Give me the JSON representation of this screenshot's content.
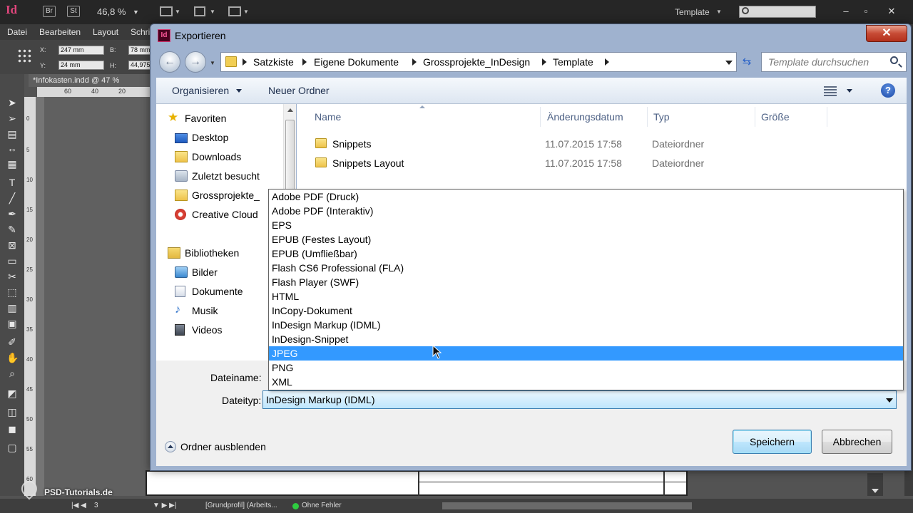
{
  "app": {
    "logo": "Id",
    "badge_bridge": "Br",
    "badge_stock": "St",
    "zoom": "46,8 %",
    "workspace": "Template",
    "menu": [
      "Datei",
      "Bearbeiten",
      "Layout",
      "Schri"
    ],
    "x_label": "X:",
    "y_label": "Y:",
    "w_label": "B:",
    "h_label": "H:",
    "x_value": "247 mm",
    "y_value": "24 mm",
    "w_value": "78 mm",
    "h_value": "44,975",
    "doc_tab": "*Infokasten.indd @ 47 %",
    "ruler_top": [
      "60",
      "40",
      "20"
    ],
    "ruler_left": [
      "0",
      "5",
      "10",
      "15",
      "20",
      "25",
      "30",
      "35",
      "40",
      "45",
      "50",
      "55",
      "60"
    ],
    "status": {
      "page": "3",
      "profile": "[Grundprofil] (Arbeits...",
      "preflight": "Ohne Fehler"
    },
    "watermark": "PSD-Tutorials.de"
  },
  "dialog": {
    "title": "Exportieren",
    "title_icon": "Id",
    "breadcrumb": [
      "Satzkiste",
      "Eigene Dokumente",
      "Grossprojekte_InDesign",
      "Template"
    ],
    "search_placeholder": "Template durchsuchen",
    "toolbar": {
      "organize": "Organisieren",
      "new_folder": "Neuer Ordner"
    },
    "nav": {
      "favorites_header": "Favoriten",
      "favorites": [
        "Desktop",
        "Downloads",
        "Zuletzt besucht",
        "Grossprojekte_",
        "Creative Cloud"
      ],
      "libraries_header": "Bibliotheken",
      "libraries": [
        "Bilder",
        "Dokumente",
        "Musik",
        "Videos"
      ]
    },
    "columns": {
      "name": "Name",
      "date": "Änderungsdatum",
      "type": "Typ",
      "size": "Größe"
    },
    "files": [
      {
        "name": "Snippets",
        "date": "11.07.2015 17:58",
        "type": "Dateiordner"
      },
      {
        "name": "Snippets Layout",
        "date": "11.07.2015 17:58",
        "type": "Dateiordner"
      }
    ],
    "filename_label": "Dateiname:",
    "filetype_label": "Dateityp:",
    "filetype_value": "InDesign Markup (IDML)",
    "filetype_options": [
      "Adobe PDF (Druck)",
      "Adobe PDF (Interaktiv)",
      "EPS",
      "EPUB (Festes Layout)",
      "EPUB (Umfließbar)",
      "Flash CS6 Professional (FLA)",
      "Flash Player (SWF)",
      "HTML",
      "InCopy-Dokument",
      "InDesign Markup (IDML)",
      "InDesign-Snippet",
      "JPEG",
      "PNG",
      "XML"
    ],
    "highlighted_option": "JPEG",
    "hide_folders": "Ordner ausblenden",
    "save_label": "Speichern",
    "cancel_label": "Abbrechen",
    "colors": {
      "selection": "#3399ff",
      "close_button": "#c74b35",
      "chrome": "#9fb2cf"
    }
  }
}
